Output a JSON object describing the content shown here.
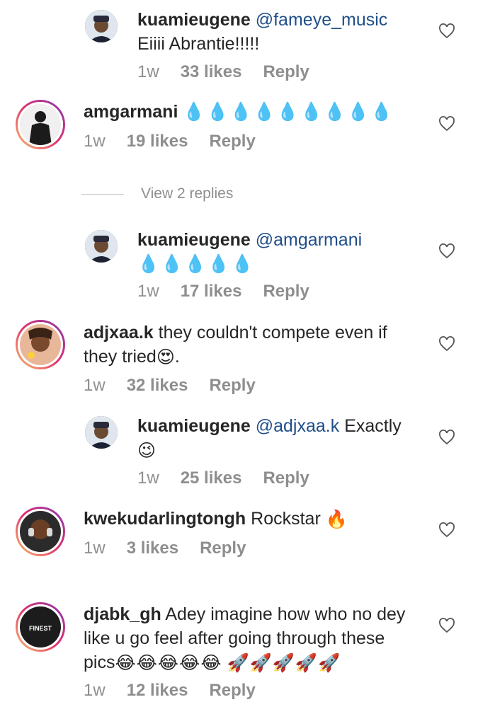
{
  "comments": [
    {
      "username": "kuamieugene",
      "mention": "@fameye_music",
      "text": "Eiiii Abrantie!!!!!",
      "time": "1w",
      "likes": "33 likes",
      "reply": "Reply"
    },
    {
      "username": "amgarmani",
      "text": "💧💧💧💧💧💧💧💧💧",
      "time": "1w",
      "likes": "19 likes",
      "reply": "Reply"
    },
    {
      "username": "kuamieugene",
      "mention": "@amgarmani",
      "text": "💧💧💧💧💧",
      "time": "1w",
      "likes": "17 likes",
      "reply": "Reply"
    },
    {
      "username": "adjxaa.k",
      "text_line1": "they couldn't compete even if",
      "text_line2": "they tried",
      "text_line2_end": ".",
      "time": "1w",
      "likes": "32 likes",
      "reply": "Reply"
    },
    {
      "username": "kuamieugene",
      "mention": "@adjxaa.k",
      "text": "Exactly",
      "time": "1w",
      "likes": "25 likes",
      "reply": "Reply"
    },
    {
      "username": "kwekudarlingtongh",
      "text": "Rockstar",
      "time": "1w",
      "likes": "3 likes",
      "reply": "Reply"
    },
    {
      "username": "djabk_gh",
      "text_line1": "Adey imagine how who no dey",
      "text_line2": "like u go feel after going through these",
      "text_line3": "pics",
      "time": "1w",
      "likes": "12 likes",
      "reply": "Reply"
    }
  ],
  "view_replies": "View 2 replies",
  "avatar_djabk_label": "FINEST",
  "icons": {
    "like": "heart-outline-icon"
  }
}
